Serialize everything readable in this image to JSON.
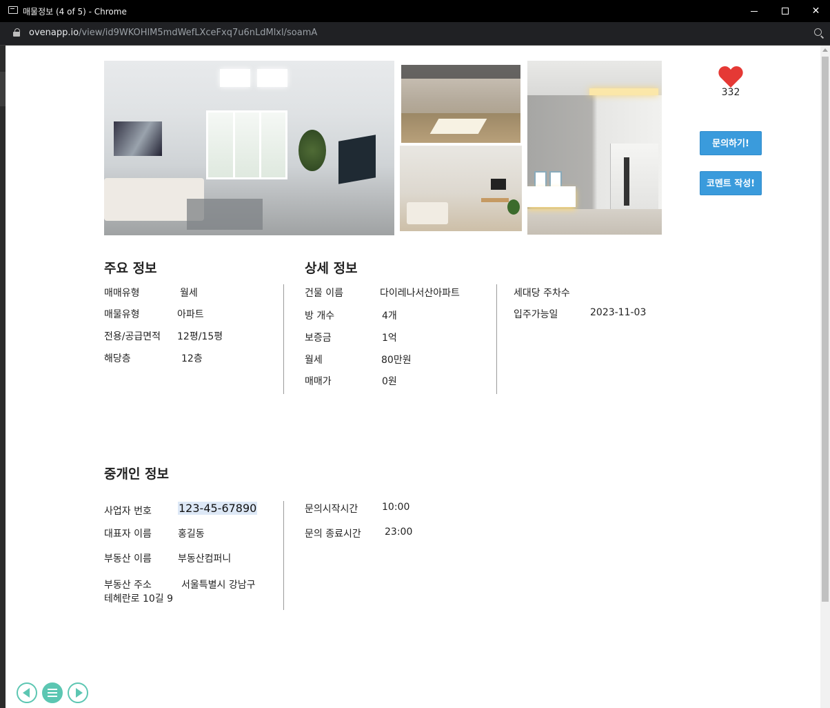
{
  "window": {
    "title": "매물정보 (4 of 5) - Chrome",
    "url_domain": "ovenapp.io",
    "url_path": "/view/id9WKOHlM5mdWefLXceFxq7u6nLdMlxl/soamA"
  },
  "likes": {
    "count": "332",
    "icon": "heart-icon",
    "color": "#e53935"
  },
  "buttons": {
    "inquire": "문의하기!",
    "comment": "코멘트 작성!",
    "color": "#3a9bdc"
  },
  "main_info": {
    "title": "주요 정보",
    "rows": [
      {
        "label": "매매유형",
        "value": "월세"
      },
      {
        "label": "매물유형",
        "value": "아파트"
      },
      {
        "label": "전용/공급면적",
        "value": "12평/15평"
      },
      {
        "label": "해당층",
        "value": "12층"
      }
    ]
  },
  "detail_info": {
    "title": "상세 정보",
    "rows": [
      {
        "label": "건물 이름",
        "value": "다이레나서산아파트"
      },
      {
        "label": "방 개수",
        "value": "4개"
      },
      {
        "label": "보증금",
        "value": "1억"
      },
      {
        "label": "월세",
        "value": "80만원"
      },
      {
        "label": "매매가",
        "value": "0원"
      }
    ],
    "extra_rows": [
      {
        "label": "세대당 주차수",
        "value": ""
      },
      {
        "label": "입주가능일",
        "value": "2023-11-03"
      }
    ]
  },
  "broker_info": {
    "title": "중개인 정보",
    "rows": [
      {
        "label": "사업자 번호",
        "value": "123-45-67890"
      },
      {
        "label": "대표자 이름",
        "value": "홍길동"
      },
      {
        "label": "부동산 이름",
        "value": "부동산컴퍼니"
      },
      {
        "label": "부동산 주소",
        "value": "서울특별시 강남구",
        "value_line2": "테헤란로 10길 9"
      }
    ],
    "hours": [
      {
        "label": "문의시작시간",
        "value": "10:00"
      },
      {
        "label": "문의 종료시간",
        "value": "23:00"
      }
    ]
  },
  "nav": {
    "accent": "#5cc6b2"
  }
}
